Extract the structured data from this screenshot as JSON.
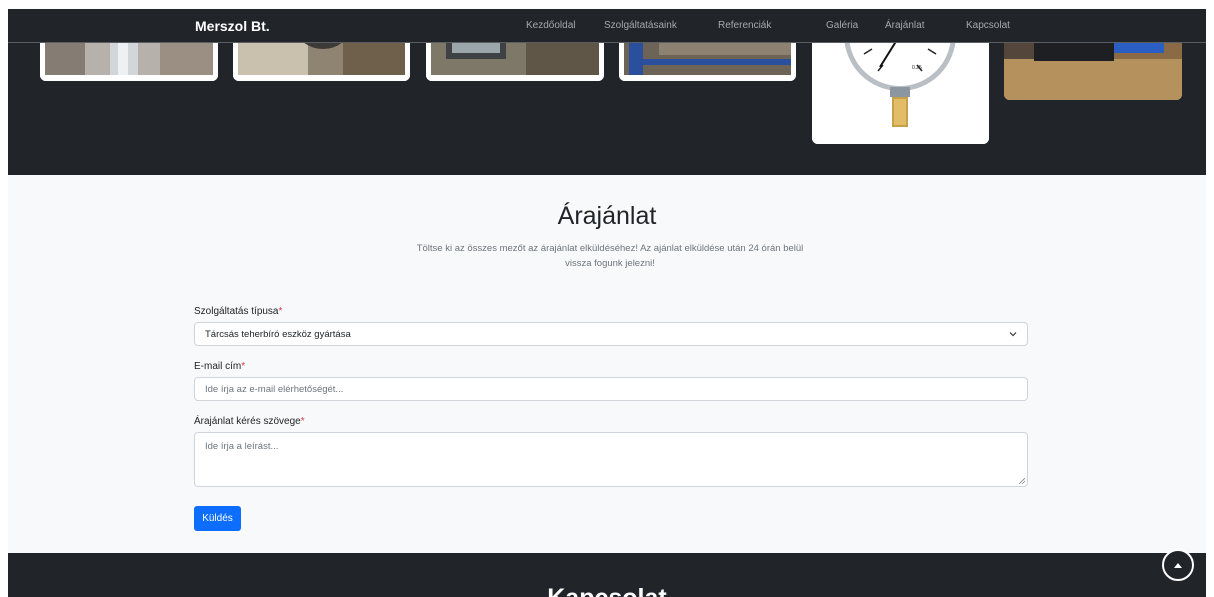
{
  "navbar": {
    "brand": "Merszol Bt.",
    "items": [
      {
        "label": "Kezdőoldal"
      },
      {
        "label": "Szolgáltatásaink"
      },
      {
        "label": "Referenciák"
      },
      {
        "label": "Galéria"
      },
      {
        "label": "Árajánlat"
      },
      {
        "label": "Kapcsolat"
      }
    ]
  },
  "gallery": {
    "gauge_text": {
      "unit": "bar",
      "reading": "0.25"
    }
  },
  "quote": {
    "title": "Árajánlat",
    "subtitle_line1": "Töltse ki az összes mezőt az árajánlat elküldéséhez! Az ajánlat elküldése után 24 órán belül",
    "subtitle_line2": "vissza fogunk jelezni!",
    "service": {
      "label": "Szolgáltatás típusa",
      "required_mark": "*",
      "selected": "Tárcsás teherbíró eszköz gyártása"
    },
    "email": {
      "label": "E-mail cím",
      "required_mark": "*",
      "placeholder": "Ide írja az e-mail elérhetőségét..."
    },
    "message": {
      "label": "Árajánlat kérés szövege",
      "required_mark": "*",
      "placeholder": "Ide írja a leírást..."
    },
    "submit_label": "Küldés"
  },
  "contact": {
    "title": "Kapcsolat"
  },
  "colors": {
    "dark": "#212529",
    "light_bg": "#f8f9fa",
    "primary": "#0d6efd",
    "required": "#dc3545",
    "muted": "#6c757d"
  },
  "icons": {
    "select": "chevron-down-icon",
    "back_to_top": "arrow-up-icon"
  }
}
